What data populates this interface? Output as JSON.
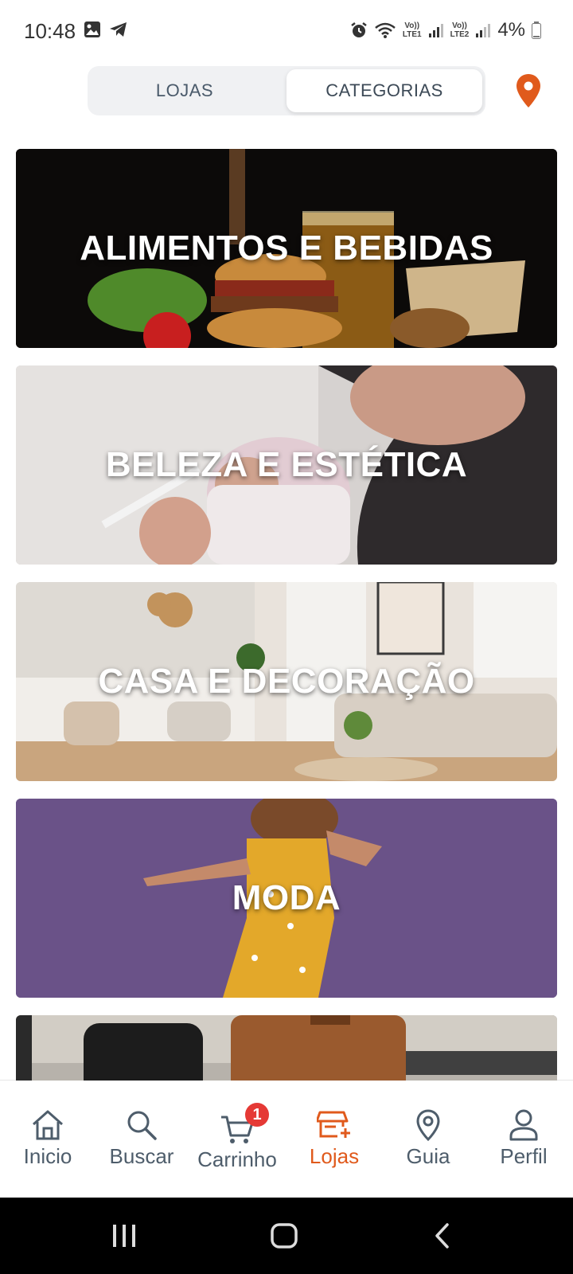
{
  "status_bar": {
    "time": "10:48",
    "lte1": "LTE1",
    "lte2": "LTE2",
    "volte": "Vo))",
    "battery": "4%"
  },
  "segment": {
    "tab_lojas": "LOJAS",
    "tab_categorias": "CATEGORIAS",
    "active": "CATEGORIAS"
  },
  "categories": [
    {
      "label": "ALIMENTOS E BEBIDAS"
    },
    {
      "label": "BELEZA E ESTÉTICA"
    },
    {
      "label": "CASA E DECORAÇÃO"
    },
    {
      "label": "MODA"
    },
    {
      "label": ""
    }
  ],
  "bottom_nav": {
    "items": [
      {
        "label": "Inicio",
        "icon": "home-icon"
      },
      {
        "label": "Buscar",
        "icon": "search-icon"
      },
      {
        "label": "Carrinho",
        "icon": "cart-icon",
        "badge": "1"
      },
      {
        "label": "Lojas",
        "icon": "store-icon",
        "active": true
      },
      {
        "label": "Guia",
        "icon": "location-pin-icon"
      },
      {
        "label": "Perfil",
        "icon": "user-icon"
      }
    ]
  },
  "colors": {
    "accent": "#e05a1c",
    "badge": "#e53935",
    "nav_text": "#4e5d6b"
  }
}
